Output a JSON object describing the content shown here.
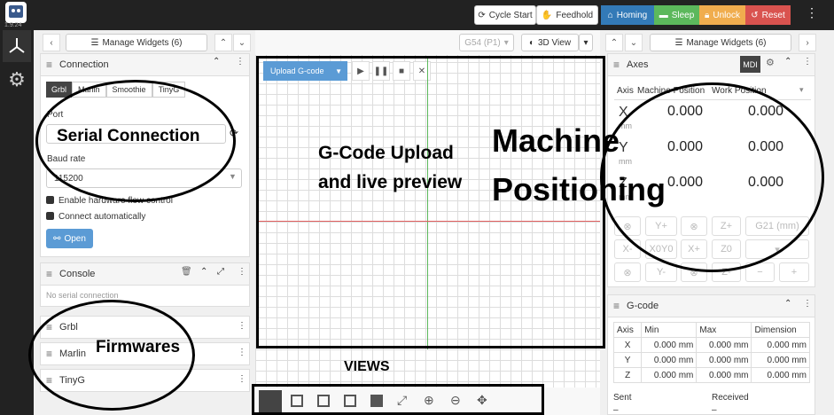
{
  "app": {
    "version": "1.9.24"
  },
  "topbar": {
    "cycle_start": "Cycle Start",
    "feedhold": "Feedhold",
    "homing": "Homing",
    "sleep": "Sleep",
    "unlock": "Unlock",
    "reset": "Reset",
    "colors": {
      "homing": "#337ab7",
      "sleep": "#5cb85c",
      "unlock": "#f0ad4e",
      "reset": "#d9534f"
    }
  },
  "left": {
    "manage_widgets": "Manage Widgets (6)",
    "connection": {
      "title": "Connection",
      "tabs": [
        "Grbl",
        "Marlin",
        "Smoothie",
        "TinyG"
      ],
      "port_label": "Port",
      "baud_label": "Baud rate",
      "baud_value": "115200",
      "flow_control": "Enable hardware flow control",
      "connect_auto": "Connect automatically",
      "open_button": "Open"
    },
    "console": {
      "title": "Console",
      "empty": "No serial connection"
    },
    "firmwares": [
      "Grbl",
      "Marlin",
      "TinyG"
    ]
  },
  "center": {
    "wcs": "G54 (P1)",
    "view_mode": "3D View",
    "upload_button": "Upload G-code",
    "view_icons": [
      "3d-view-icon",
      "top-view-icon",
      "front-view-icon",
      "right-view-icon",
      "left-view-icon",
      "fit-icon",
      "zoom-in-icon",
      "zoom-out-icon",
      "pan-icon"
    ]
  },
  "right": {
    "manage_widgets": "Manage Widgets (6)",
    "axes": {
      "title": "Axes",
      "mdi": "MDI",
      "col_axis": "Axis",
      "col_machine": "Machine Position",
      "col_work": "Work Position",
      "rows": [
        {
          "axis": "X",
          "unit": "mm",
          "machine": "0.000",
          "work": "0.000"
        },
        {
          "axis": "Y",
          "unit": "mm",
          "machine": "0.000",
          "work": "0.000"
        },
        {
          "axis": "Z",
          "unit": "mm",
          "machine": "0.000",
          "work": "0.000"
        }
      ],
      "jog": {
        "y_plus": "Y+",
        "z_plus": "Z+",
        "units": "G21 (mm)",
        "x_minus": "X-",
        "xy_zero": "X0Y0",
        "x_plus": "X+",
        "z_zero": "Z0",
        "y_minus": "Y-",
        "z_minus": "Z-"
      }
    },
    "gcode": {
      "title": "G-code",
      "headers": [
        "Axis",
        "Min",
        "Max",
        "Dimension"
      ],
      "rows": [
        [
          "X",
          "0.000 mm",
          "0.000 mm",
          "0.000 mm"
        ],
        [
          "Y",
          "0.000 mm",
          "0.000 mm",
          "0.000 mm"
        ],
        [
          "Z",
          "0.000 mm",
          "0.000 mm",
          "0.000 mm"
        ]
      ],
      "sent": "Sent",
      "received": "Received",
      "sent_value": "–",
      "received_value": "–"
    }
  },
  "annotations": {
    "serial": "Serial Connection",
    "upload": "G-Code Upload",
    "upload2": "and live preview",
    "machine": "Machine",
    "positioning": "Positioning",
    "firmwares": "Firmwares",
    "views": "VIEWS"
  }
}
